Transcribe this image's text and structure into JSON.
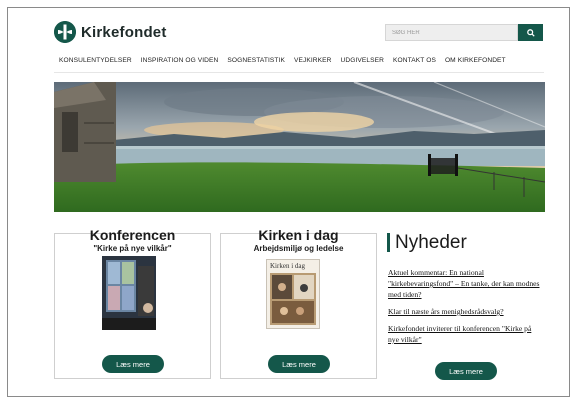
{
  "header": {
    "logo_text": "Kirkefondet",
    "search_placeholder": "SØG HER"
  },
  "nav": {
    "items": [
      "KONSULENTYDELSER",
      "INSPIRATION OG VIDEN",
      "SOGNESTATISTIK",
      "VEJKIRKER",
      "UDGIVELSER",
      "KONTAKT OS",
      "OM KIRKEFONDET"
    ]
  },
  "cards": [
    {
      "title": "Konferencen",
      "subtitle": "\"Kirke på nye vilkår\"",
      "button": "Læs mere"
    },
    {
      "title": "Kirken i dag",
      "subtitle": "Arbejdsmiljø og ledelse",
      "book_title": "Kirken i dag",
      "button": "Læs mere"
    }
  ],
  "news": {
    "title": "Nyheder",
    "items": [
      "Aktuel kommentar: En national \"kirkebevaringsfond\" – En tanke, der kan modnes med tiden?",
      "Klar til næste års menighedsrådsvalg?",
      "Kirkefondet inviterer til konferencen \"Kirke på nye vilkår\""
    ],
    "button": "Læs mere"
  },
  "colors": {
    "brand": "#14574a",
    "grass": "#3f7d2a",
    "sea": "#9fb6bf"
  }
}
